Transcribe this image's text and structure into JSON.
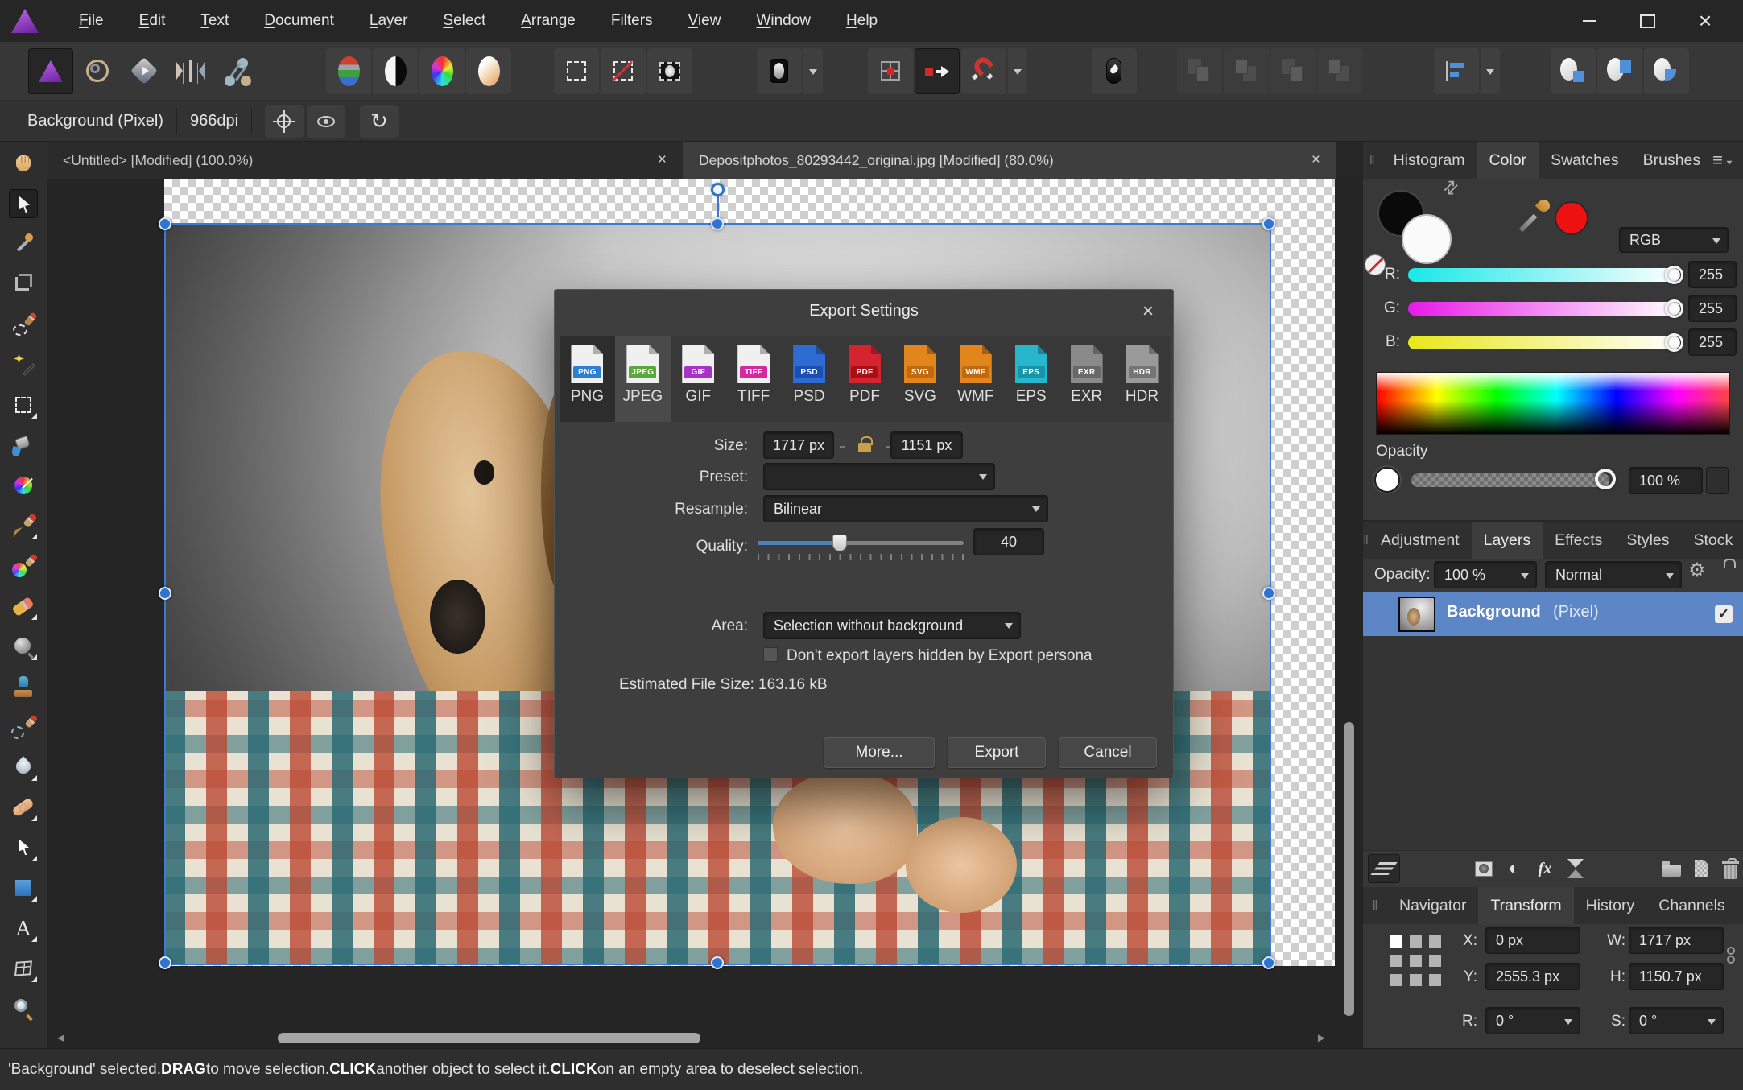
{
  "menu": {
    "items": [
      {
        "label": "File",
        "accel": true
      },
      {
        "label": "Edit",
        "accel": true
      },
      {
        "label": "Text",
        "accel": true
      },
      {
        "label": "Document",
        "accel": true
      },
      {
        "label": "Layer",
        "accel": true
      },
      {
        "label": "Select",
        "accel": true
      },
      {
        "label": "Arrange",
        "accel": true
      },
      {
        "label": "Filters",
        "accel": false
      },
      {
        "label": "View",
        "accel": true
      },
      {
        "label": "Window",
        "accel": true
      },
      {
        "label": "Help",
        "accel": true
      }
    ]
  },
  "context_toolbar": {
    "layer_label": "Background (Pixel)",
    "dpi": "966dpi"
  },
  "tabs": [
    {
      "label": "<Untitled> [Modified] (100.0%)",
      "close": "×"
    },
    {
      "label": "Depositphotos_80293442_original.jpg [Modified] (80.0%)",
      "close": "×"
    }
  ],
  "left_toolbar": {
    "selected": "move-tool",
    "flyout_indices": [
      6,
      9,
      11,
      12,
      15,
      16,
      17,
      18,
      19,
      20
    ],
    "tools": [
      "view-tool",
      "move-tool",
      "color-picker-tool",
      "crop-tool",
      "selection-brush-tool",
      "flood-select-tool",
      "marquee-tool",
      "flood-fill-tool",
      "gradient-tool",
      "paint-brush-tool",
      "colour-replacement-brush-tool",
      "erase-brush-tool",
      "dodge-brush-tool",
      "clone-stamp-tool",
      "undo-brush-tool",
      "blur-tool",
      "healing-brush-tool",
      "node-tool",
      "rectangle-tool",
      "text-tool",
      "mesh-warp-tool",
      "zoom-tool"
    ]
  },
  "dialog": {
    "title": "Export Settings",
    "close": "×",
    "formats": [
      {
        "name": "PNG",
        "page": "#f0f0f0",
        "badge": "#2b7fd4"
      },
      {
        "name": "JPEG",
        "page": "#f0f0f0",
        "badge": "#58a83c",
        "selected": true
      },
      {
        "name": "GIF",
        "page": "#f0f0f0",
        "badge": "#a832c8"
      },
      {
        "name": "TIFF",
        "page": "#f0f0f0",
        "badge": "#d828a0"
      },
      {
        "name": "PSD",
        "page": "#2e6cd4",
        "badge": "#1d4fb2"
      },
      {
        "name": "PDF",
        "page": "#d42430",
        "badge": "#a81018"
      },
      {
        "name": "SVG",
        "page": "#e2851c",
        "badge": "#c06a10"
      },
      {
        "name": "WMF",
        "page": "#e2851c",
        "badge": "#c06a10"
      },
      {
        "name": "EPS",
        "page": "#28b6cc",
        "badge": "#1694aa"
      },
      {
        "name": "EXR",
        "page": "#8a8a8a",
        "badge": "#686868"
      },
      {
        "name": "HDR",
        "page": "#9a9a9a",
        "badge": "#747474"
      }
    ],
    "fields": {
      "size_label": "Size:",
      "width_value": "1717 px",
      "height_value": "1151 px",
      "preset_label": "Preset:",
      "preset_value": "",
      "resample_label": "Resample:",
      "resample_value": "Bilinear",
      "quality_label": "Quality:",
      "quality_value": "40",
      "quality_percent": 40,
      "area_label": "Area:",
      "area_value": "Selection without background",
      "checkbox_label": "Don't export layers hidden by Export persona",
      "checkbox_checked": false,
      "estimate_label": "Estimated File Size:",
      "estimate_value": "163.16 kB"
    },
    "buttons": {
      "more": "More...",
      "export": "Export",
      "cancel": "Cancel"
    }
  },
  "color_panel": {
    "tabs": [
      "Histogram",
      "Color",
      "Swatches",
      "Brushes"
    ],
    "active_tab": "Color",
    "mode": "RGB",
    "sliders": [
      {
        "label": "R:",
        "value": "255"
      },
      {
        "label": "G:",
        "value": "255"
      },
      {
        "label": "B:",
        "value": "255"
      }
    ],
    "opacity_label": "Opacity",
    "opacity_value": "100 %",
    "picked_color": "#ee1111"
  },
  "layers_panel": {
    "tabs": [
      "Adjustment",
      "Layers",
      "Effects",
      "Styles",
      "Stock"
    ],
    "active_tab": "Layers",
    "opacity_label": "Opacity:",
    "opacity_value": "100 %",
    "blend_mode": "Normal",
    "layer": {
      "name": "Background",
      "type": "(Pixel)",
      "visible": true,
      "check": "✓"
    },
    "selected_row_color": "#5c86c5"
  },
  "transform_panel": {
    "tabs": [
      "Navigator",
      "Transform",
      "History",
      "Channels"
    ],
    "active_tab": "Transform",
    "fields": [
      {
        "label": "X:",
        "value": "0 px"
      },
      {
        "label": "Y:",
        "value": "2555.3 px"
      },
      {
        "label": "W:",
        "value": "1717 px"
      },
      {
        "label": "H:",
        "value": "1150.7 px"
      },
      {
        "label": "R:",
        "value": "0 °"
      },
      {
        "label": "S:",
        "value": "0 °"
      }
    ]
  },
  "status_bar": {
    "parts": [
      {
        "t": "'Background' selected. "
      },
      {
        "t": "DRAG",
        "b": true
      },
      {
        "t": " to move selection. "
      },
      {
        "t": "CLICK",
        "b": true
      },
      {
        "t": " another object to select it. "
      },
      {
        "t": "CLICK",
        "b": true
      },
      {
        "t": " on an empty area to deselect selection."
      }
    ]
  },
  "colors": {
    "accent_blue": "#4f81bd",
    "selection_blue": "#3a7bd5",
    "layer_selected": "#5c86c5",
    "panel_bg": "#383838",
    "dialog_bg": "#3e3e3e"
  }
}
